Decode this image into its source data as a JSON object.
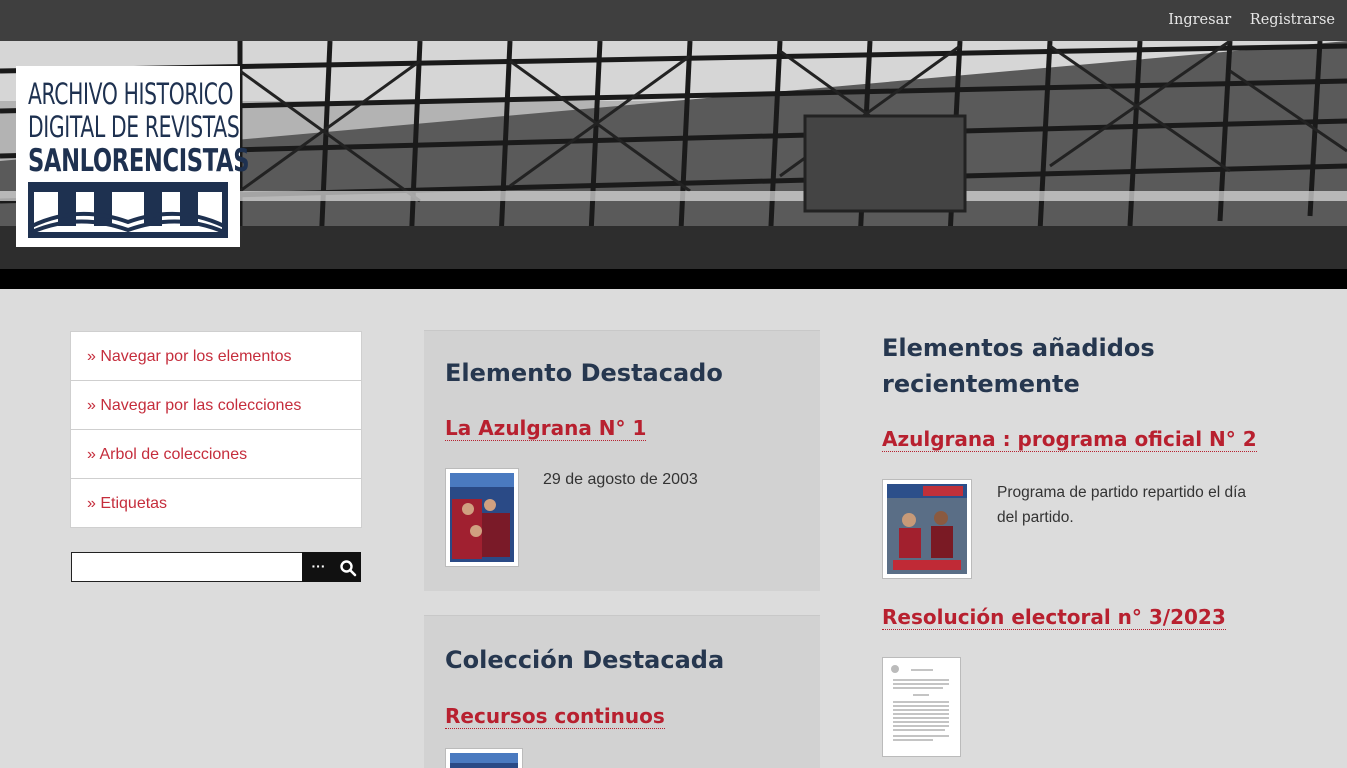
{
  "topbar": {
    "login_label": "Ingresar",
    "register_label": "Registrarse"
  },
  "logo": {
    "line1": "ARCHIVO HISTORICO",
    "line2": "DIGITAL DE REVISTAS",
    "line3": "SANLORENCISTAS"
  },
  "sidebar": {
    "items": [
      {
        "label": "» Navegar por los elementos"
      },
      {
        "label": "» Navegar por las colecciones"
      },
      {
        "label": "» Arbol de colecciones"
      },
      {
        "label": "» Etiquetas"
      }
    ]
  },
  "search": {
    "value": "",
    "advanced_label": "···"
  },
  "featured_item": {
    "heading": "Elemento Destacado",
    "title": "La Azulgrana N° 1",
    "date": "29 de agosto de 2003"
  },
  "featured_collection": {
    "heading": "Colección Destacada",
    "title": "Recursos continuos"
  },
  "recent": {
    "heading": "Elementos añadidos recientemente",
    "items": [
      {
        "title": "Azulgrana : programa oficial N° 2",
        "description": "Programa de partido repartido el día del partido."
      },
      {
        "title": "Resolución electoral n° 3/2023"
      }
    ]
  },
  "colors": {
    "accent": "#b8202f",
    "link": "#c52d3c",
    "heading": "#26374f",
    "topbar": "#3f3f3f"
  }
}
